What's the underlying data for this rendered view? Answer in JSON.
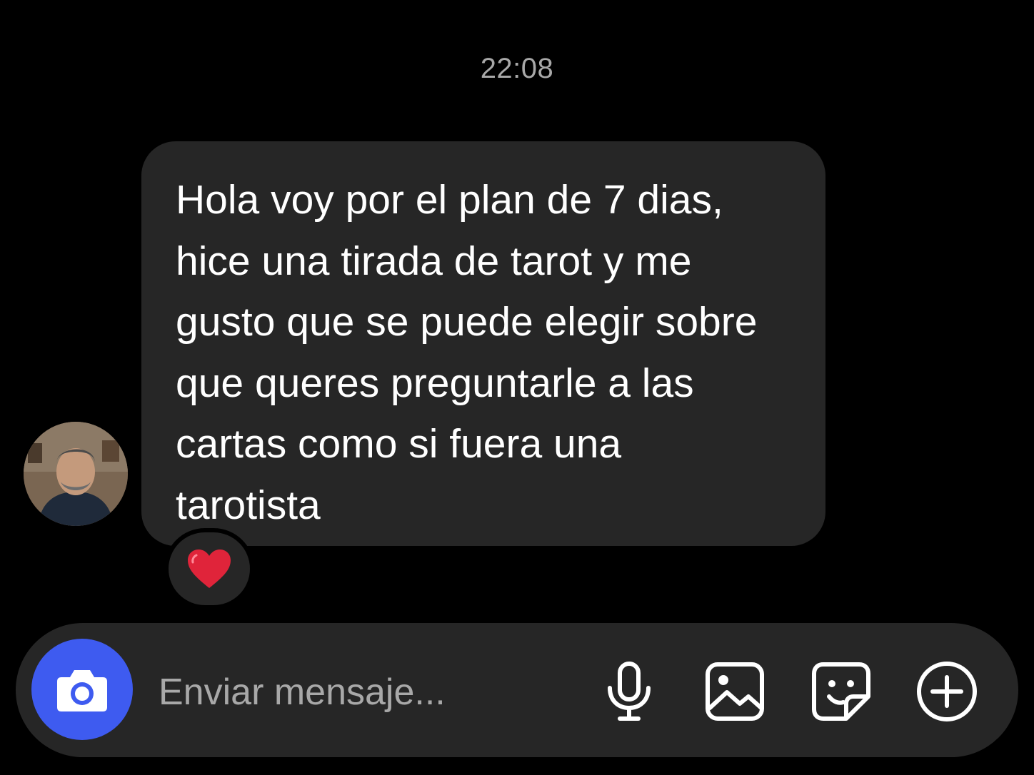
{
  "header": {
    "timestamp": "22:08"
  },
  "message": {
    "sender_avatar": "avatar-photo",
    "text": "Hola voy por el plan de 7 dias,\nhice una tirada de tarot y me\ngusto que se puede elegir sobre\nque queres preguntarle a las\ncartas como si fuera una\ntarotista",
    "reaction": "❤️"
  },
  "composer": {
    "placeholder": "Enviar mensaje...",
    "value": "",
    "icons": [
      "camera-icon",
      "microphone-icon",
      "image-icon",
      "sticker-icon",
      "plus-circle-icon"
    ]
  },
  "colors": {
    "background": "#000000",
    "bubble": "#262626",
    "accent": "#3e5bf0",
    "timestamp": "#a8a8a8",
    "heart": "#e0243a"
  }
}
